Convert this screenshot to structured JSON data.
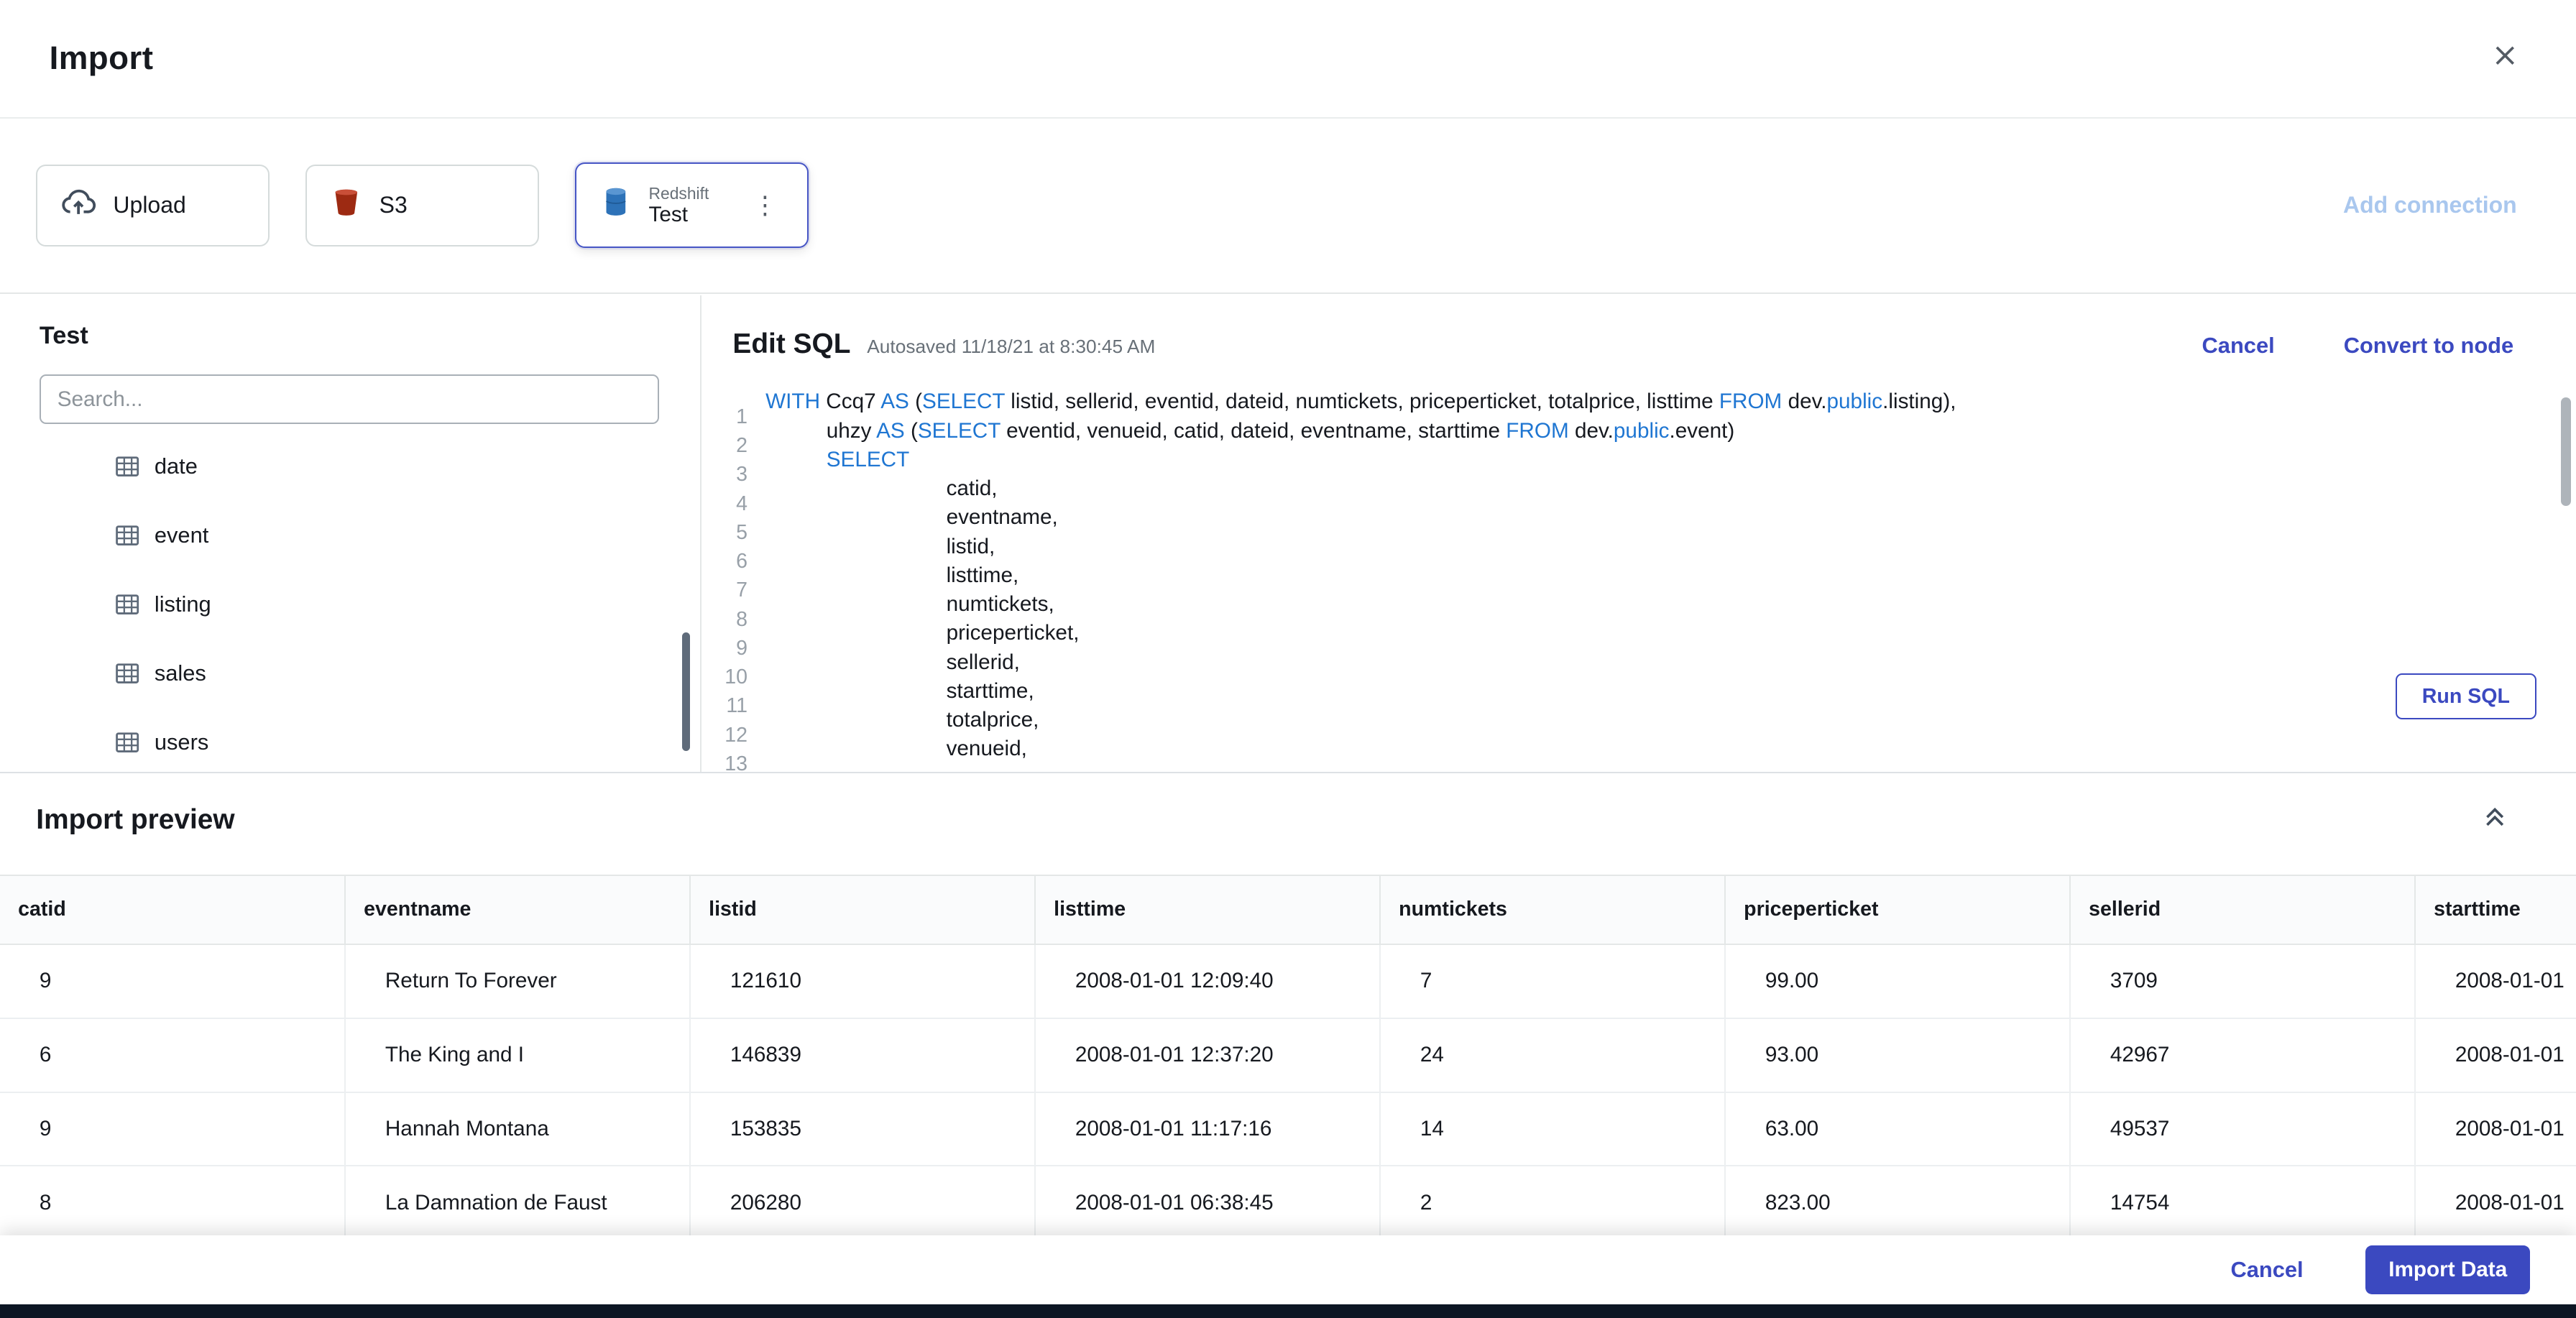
{
  "colors": {
    "accent": "#3b49c0",
    "sql_keyword": "#1f76d2",
    "disabled_link": "#a9c7ee"
  },
  "header": {
    "title": "Import"
  },
  "connections": {
    "upload": "Upload",
    "s3": "S3",
    "redshift_type": "Redshift",
    "redshift_name": "Test",
    "add": "Add connection"
  },
  "left_panel": {
    "title": "Test",
    "search_placeholder": "Search...",
    "search_value": "",
    "tables": [
      "date",
      "event",
      "listing",
      "sales",
      "users"
    ]
  },
  "sql_panel": {
    "title": "Edit SQL",
    "autosaved": "Autosaved 11/18/21 at 8:30:45 AM",
    "cancel": "Cancel",
    "convert": "Convert to node",
    "run": "Run SQL",
    "lines": [
      {
        "ind": 0,
        "tok": [
          [
            "k",
            "WITH"
          ],
          [
            "t",
            " Ccq7 "
          ],
          [
            "k",
            "AS"
          ],
          [
            "t",
            " ("
          ],
          [
            "k",
            "SELECT"
          ],
          [
            "t",
            " listid, sellerid, eventid, dateid, numtickets, priceperticket, totalprice, listtime "
          ],
          [
            "k",
            "FROM"
          ],
          [
            "t",
            " dev."
          ],
          [
            "k",
            "public"
          ],
          [
            "t",
            ".listing),"
          ]
        ]
      },
      {
        "ind": 1,
        "tok": [
          [
            "t",
            "uhzy "
          ],
          [
            "k",
            "AS"
          ],
          [
            "t",
            " ("
          ],
          [
            "k",
            "SELECT"
          ],
          [
            "t",
            " eventid, venueid, catid, dateid, eventname, starttime "
          ],
          [
            "k",
            "FROM"
          ],
          [
            "t",
            " dev."
          ],
          [
            "k",
            "public"
          ],
          [
            "t",
            ".event)"
          ]
        ]
      },
      {
        "ind": 1,
        "tok": [
          [
            "k",
            "SELECT"
          ]
        ]
      },
      {
        "ind": 2,
        "tok": [
          [
            "t",
            "catid,"
          ]
        ]
      },
      {
        "ind": 2,
        "tok": [
          [
            "t",
            "eventname,"
          ]
        ]
      },
      {
        "ind": 2,
        "tok": [
          [
            "t",
            "listid,"
          ]
        ]
      },
      {
        "ind": 2,
        "tok": [
          [
            "t",
            "listtime,"
          ]
        ]
      },
      {
        "ind": 2,
        "tok": [
          [
            "t",
            "numtickets,"
          ]
        ]
      },
      {
        "ind": 2,
        "tok": [
          [
            "t",
            "priceperticket,"
          ]
        ]
      },
      {
        "ind": 2,
        "tok": [
          [
            "t",
            "sellerid,"
          ]
        ]
      },
      {
        "ind": 2,
        "tok": [
          [
            "t",
            "starttime,"
          ]
        ]
      },
      {
        "ind": 2,
        "tok": [
          [
            "t",
            "totalprice,"
          ]
        ]
      },
      {
        "ind": 2,
        "tok": [
          [
            "t",
            "venueid,"
          ]
        ]
      }
    ]
  },
  "preview": {
    "title": "Import preview",
    "columns": [
      "catid",
      "eventname",
      "listid",
      "listtime",
      "numtickets",
      "priceperticket",
      "sellerid",
      "starttime"
    ],
    "rows": [
      [
        "9",
        "Return To Forever",
        "121610",
        "2008-01-01 12:09:40",
        "7",
        "99.00",
        "3709",
        "2008-01-01"
      ],
      [
        "6",
        "The King and I",
        "146839",
        "2008-01-01 12:37:20",
        "24",
        "93.00",
        "42967",
        "2008-01-01"
      ],
      [
        "9",
        "Hannah Montana",
        "153835",
        "2008-01-01 11:17:16",
        "14",
        "63.00",
        "49537",
        "2008-01-01"
      ],
      [
        "8",
        "La Damnation de Faust",
        "206280",
        "2008-01-01 06:38:45",
        "2",
        "823.00",
        "14754",
        "2008-01-01"
      ]
    ]
  },
  "footer": {
    "cancel": "Cancel",
    "import": "Import Data"
  }
}
